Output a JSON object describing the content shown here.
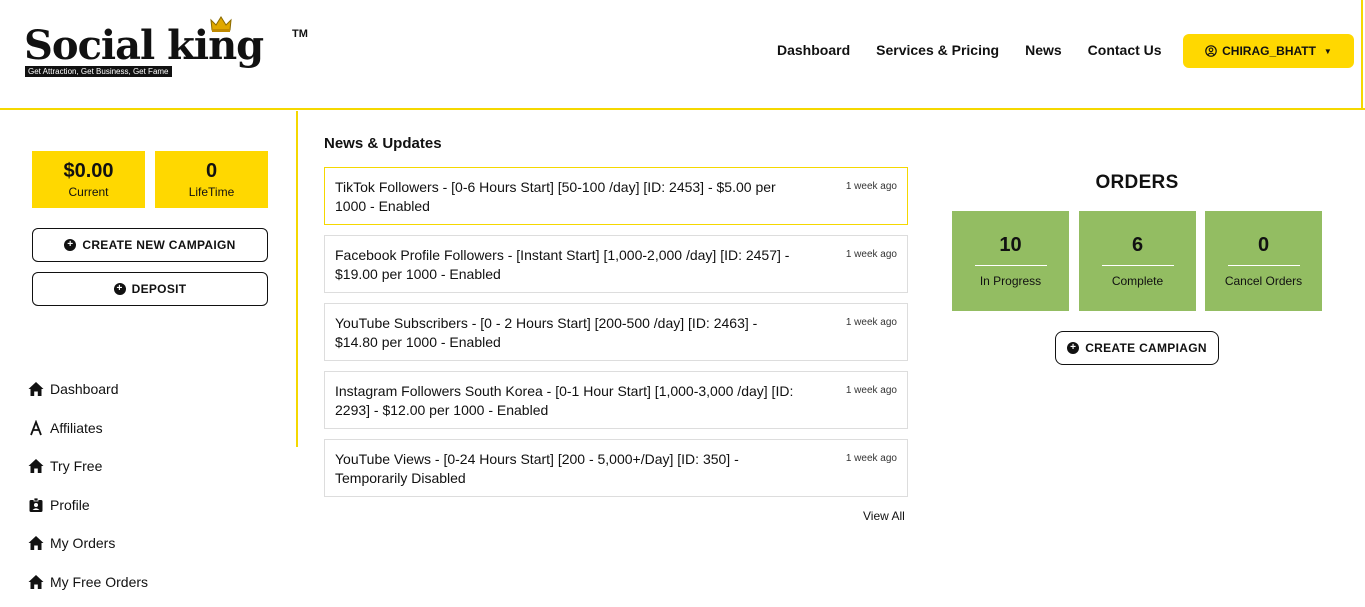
{
  "logo": {
    "text": "Social king",
    "tm": "TM",
    "tagline": "Get Attraction, Get Business, Get Fame"
  },
  "nav": {
    "items": [
      "Dashboard",
      "Services & Pricing",
      "News",
      "Contact Us"
    ]
  },
  "user": {
    "name": "CHIRAG_BHATT"
  },
  "stats": {
    "current": {
      "value": "$0.00",
      "label": "Current"
    },
    "lifetime": {
      "value": "0",
      "label": "LifeTime"
    }
  },
  "buttons": {
    "create_new_campaign": "CREATE NEW CAMPAIGN",
    "deposit": "DEPOSIT",
    "create_campaign": "CREATE CAMPIAGN"
  },
  "sidebar": {
    "items": [
      {
        "label": "Dashboard",
        "icon": "home-icon"
      },
      {
        "label": "Affiliates",
        "icon": "affiliate-icon"
      },
      {
        "label": "Try Free",
        "icon": "home-icon"
      },
      {
        "label": "Profile",
        "icon": "id-badge-icon"
      },
      {
        "label": "My Orders",
        "icon": "home-icon"
      },
      {
        "label": "My Free Orders",
        "icon": "home-icon"
      }
    ]
  },
  "news": {
    "title": "News & Updates",
    "items": [
      {
        "text": "TikTok Followers - [0-6 Hours Start] [50-100 /day] [ID: 2453] - $5.00 per 1000 - Enabled",
        "time": "1 week ago"
      },
      {
        "text": "Facebook Profile Followers - [Instant Start] [1,000-2,000 /day] [ID: 2457] - $19.00 per 1000 - Enabled",
        "time": "1 week ago"
      },
      {
        "text": "YouTube Subscribers - [0 - 2 Hours Start] [200-500 /day] [ID: 2463] - $14.80 per 1000 - Enabled",
        "time": "1 week ago"
      },
      {
        "text": "Instagram Followers South Korea - [0-1 Hour Start] [1,000-3,000 /day] [ID: 2293] - $12.00 per 1000 - Enabled",
        "time": "1 week ago"
      },
      {
        "text": "YouTube Views - [0-24 Hours Start] [200 - 5,000+/Day] [ID: 350] - Temporarily Disabled",
        "time": "1 week ago"
      }
    ],
    "view_all": "View All"
  },
  "orders": {
    "title": "ORDERS",
    "boxes": [
      {
        "value": "10",
        "label": "In Progress"
      },
      {
        "value": "6",
        "label": "Complete"
      },
      {
        "value": "0",
        "label": "Cancel Orders"
      }
    ]
  },
  "colors": {
    "accent": "#ffd800",
    "orders_green": "#93bd62"
  }
}
